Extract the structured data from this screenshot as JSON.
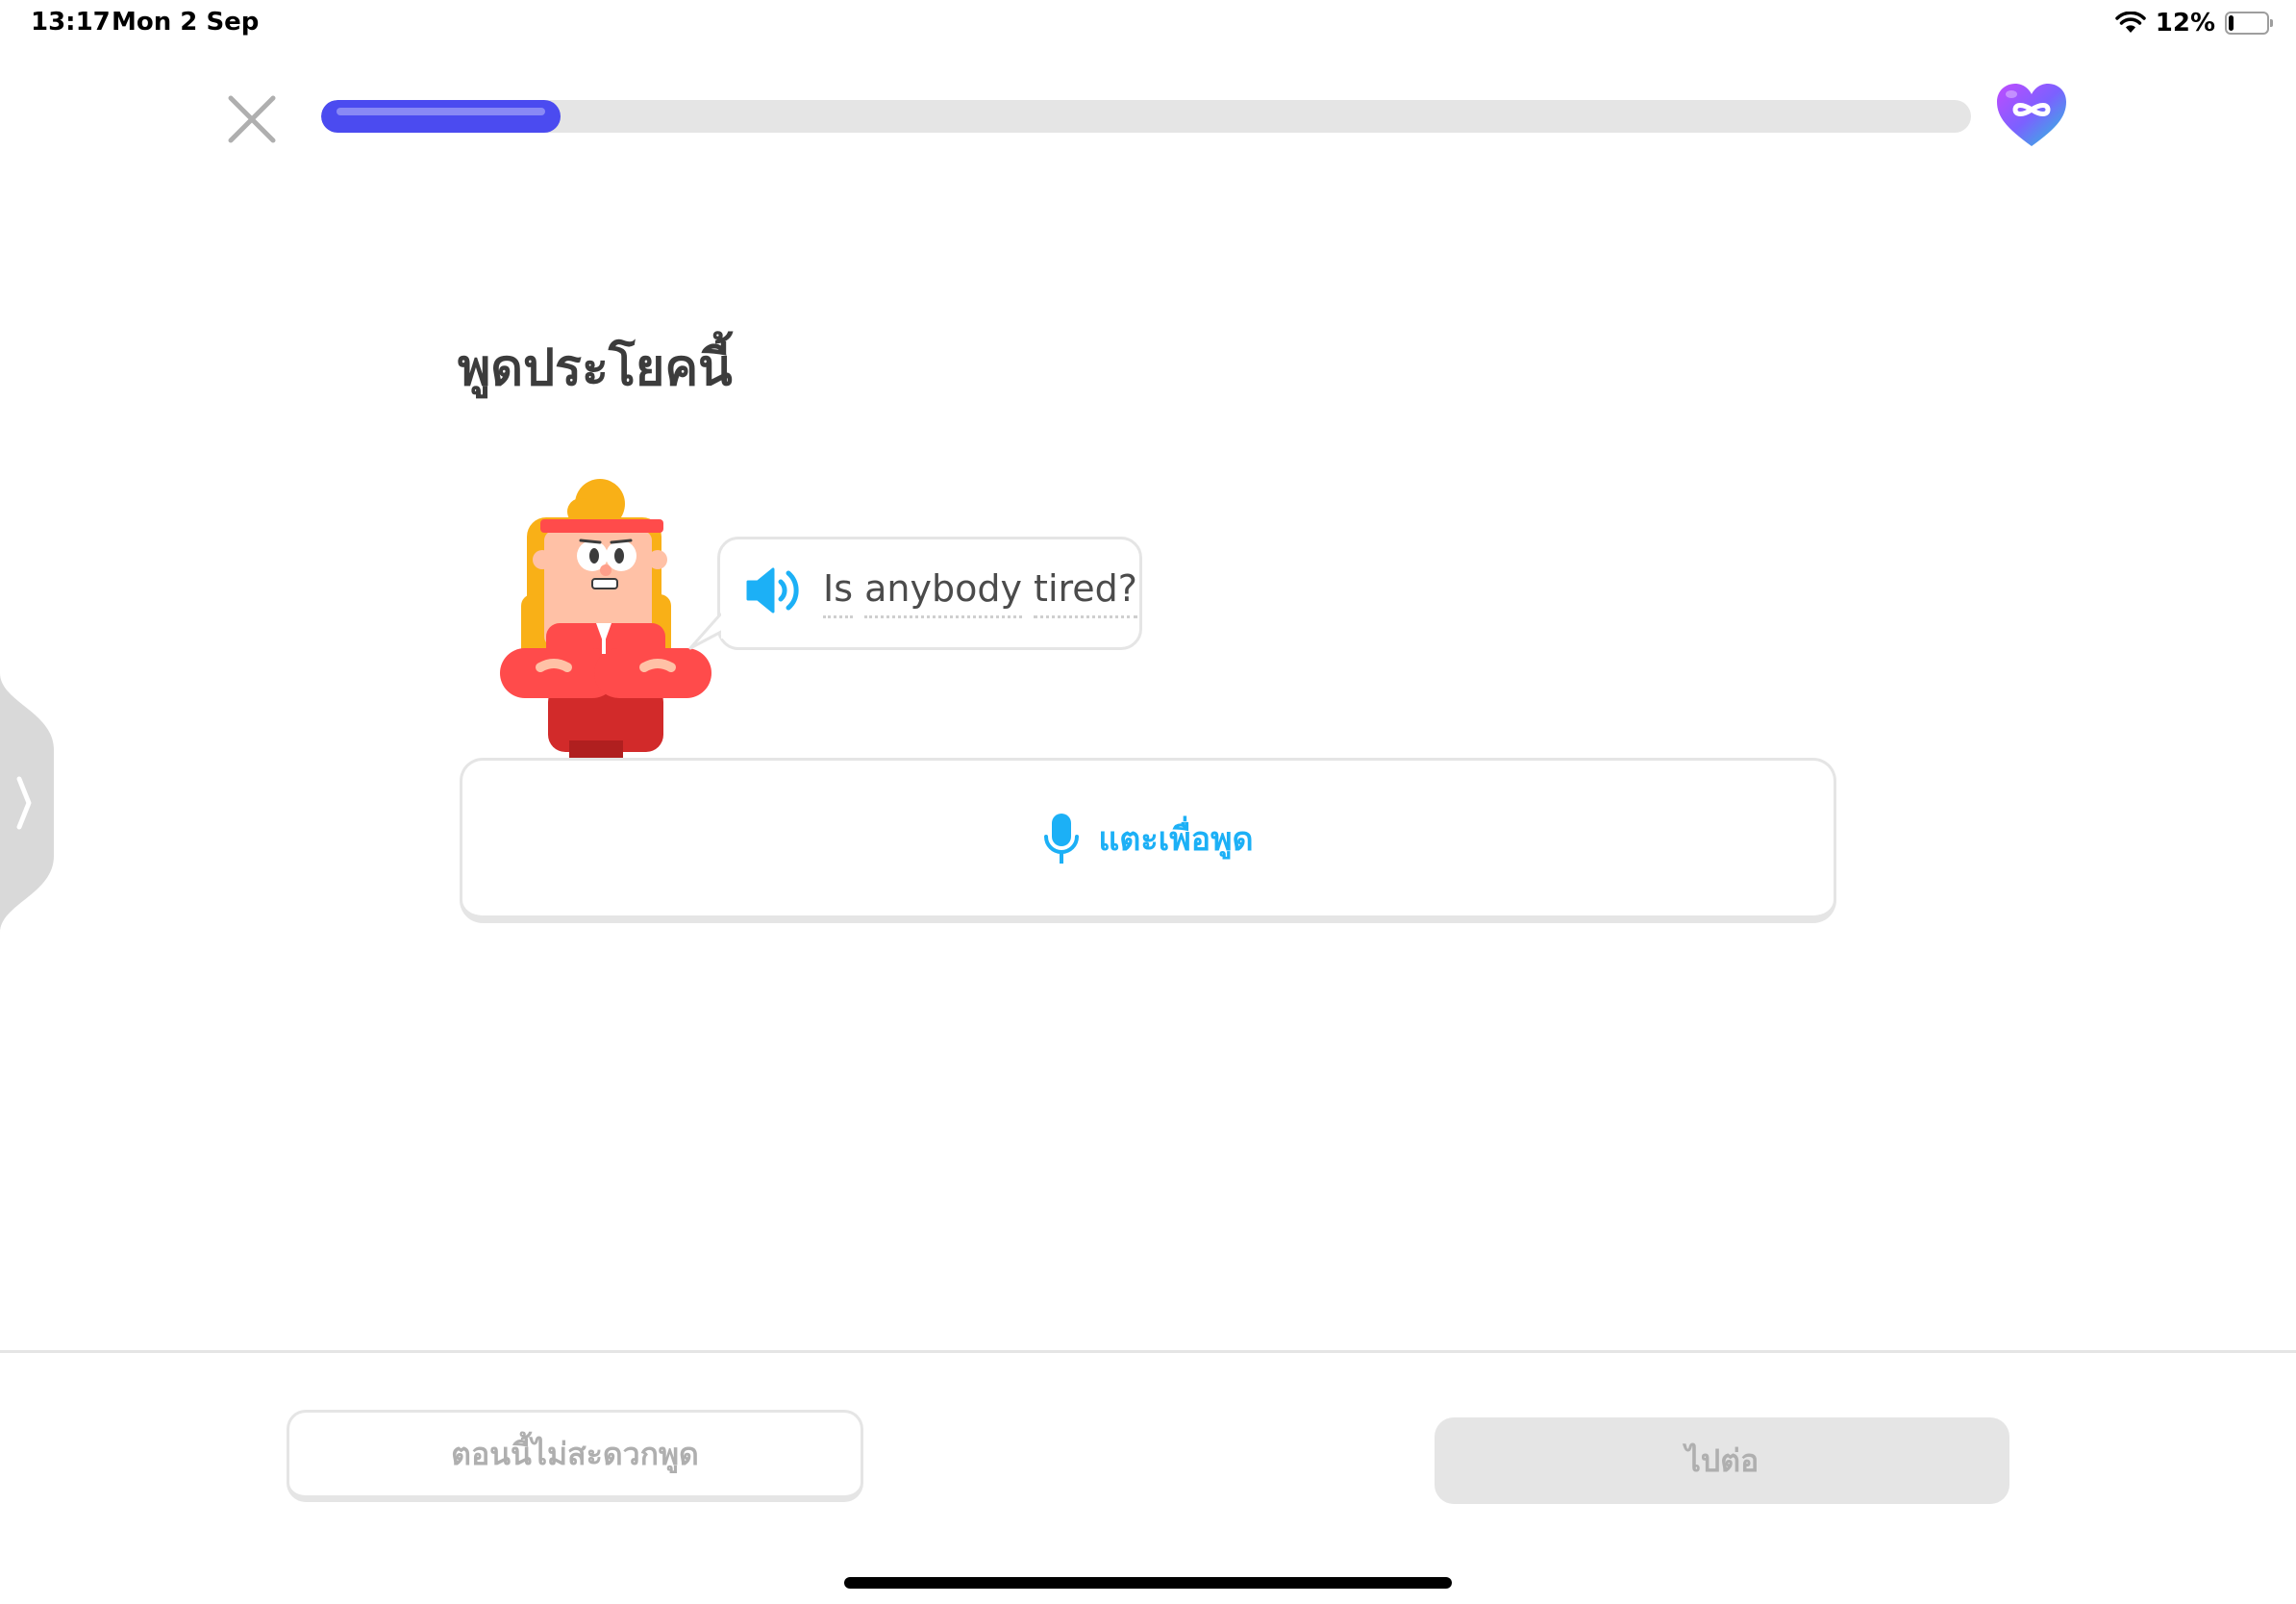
{
  "status_bar": {
    "time": "13:17",
    "date": "Mon 2 Sep",
    "battery_percent": "12%",
    "battery_level": 0.12,
    "icons": [
      "wifi-icon",
      "battery-icon"
    ]
  },
  "lesson": {
    "progress_fraction": 0.145,
    "close_icon": "close-icon",
    "hearts_icon": "infinity-heart-icon"
  },
  "exercise": {
    "title": "พูดประโยคนี้",
    "sentence_words": [
      "Is",
      "anybody",
      "tired?"
    ],
    "speaker_icon": "speaker-icon",
    "tap_to_speak_label": "แตะเพื่อพูด",
    "mic_icon": "microphone-icon"
  },
  "footer": {
    "cant_speak_label": "ตอนนี้ไม่สะดวกพูด",
    "continue_label": "ไปต่อ"
  },
  "colors": {
    "accent_blue": "#1cb0f6",
    "progress": "#4b4bf0",
    "disabled_gray": "#afafaf",
    "border_gray": "#e5e5e5"
  }
}
